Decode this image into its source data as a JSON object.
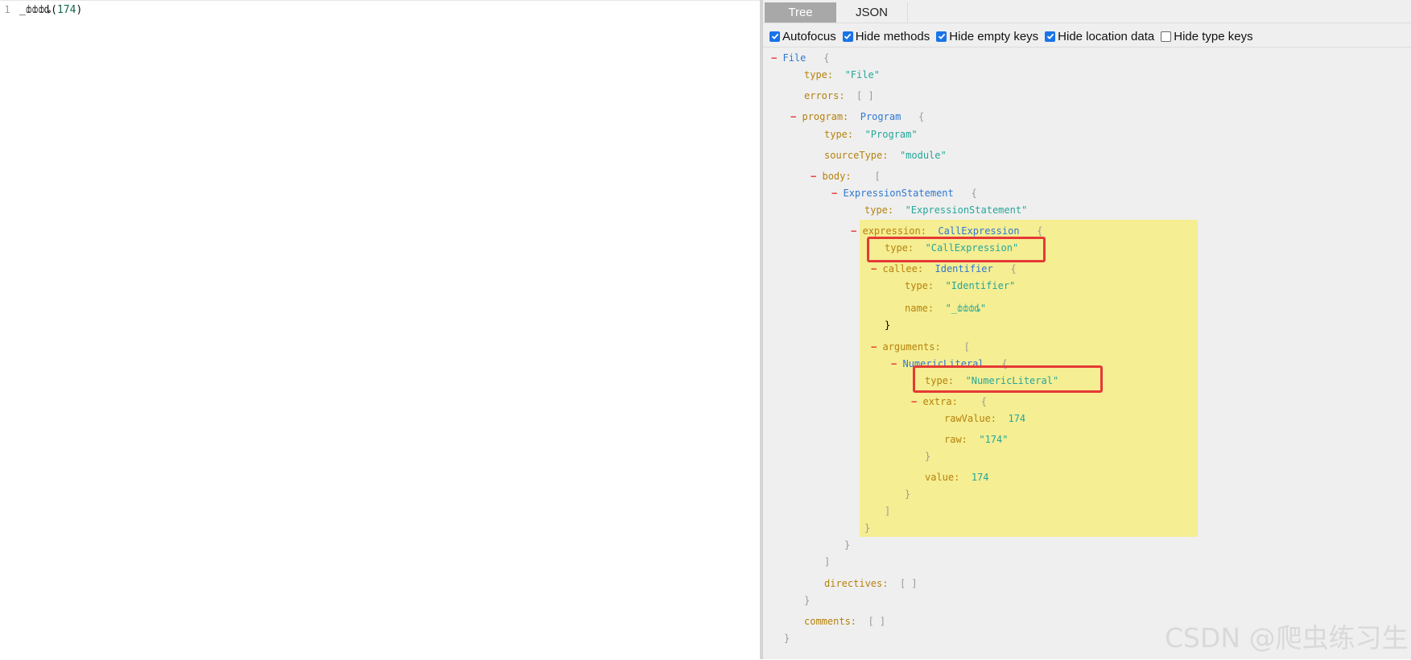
{
  "editor": {
    "line_number": "1",
    "code_ident": "_ȸȸȸȡ",
    "code_open": "(",
    "code_arg": "174",
    "code_close": ")"
  },
  "tabs": [
    "Tree",
    "JSON"
  ],
  "options": [
    {
      "label": "Autofocus",
      "checked": true
    },
    {
      "label": "Hide methods",
      "checked": true
    },
    {
      "label": "Hide empty keys",
      "checked": true
    },
    {
      "label": "Hide location data",
      "checked": true
    },
    {
      "label": "Hide type keys",
      "checked": false
    }
  ],
  "colors": {
    "highlight": "#f5ee92",
    "annotation_box": "#e53935",
    "toggle": "#e53935"
  },
  "tree": {
    "file": {
      "toggle": "−",
      "type_name": "File",
      "brace": "{",
      "type_key": "type:",
      "type_val": "\"File\"",
      "errors_key": "errors:",
      "errors_val": "[ ]",
      "close": "}"
    },
    "program": {
      "toggle": "−",
      "key": "program:",
      "type_name": "Program",
      "brace": "{",
      "type_key": "type:",
      "type_val": "\"Program\"",
      "sourcetype_key": "sourceType:",
      "sourcetype_val": "\"module\"",
      "directives_key": "directives:",
      "directives_val": "[ ]",
      "close": "}"
    },
    "body": {
      "toggle": "−",
      "key": "body:",
      "brace": "[",
      "close": "]"
    },
    "expr_stmt": {
      "toggle": "−",
      "type_name": "ExpressionStatement",
      "brace": "{",
      "type_key": "type:",
      "type_val": "\"ExpressionStatement\"",
      "close": "}"
    },
    "expression": {
      "toggle": "−",
      "key": "expression:",
      "type_name": "CallExpression",
      "brace": "{",
      "type_key": "type:",
      "type_val": "\"CallExpression\"",
      "close": "}"
    },
    "callee": {
      "toggle": "−",
      "key": "callee:",
      "type_name": "Identifier",
      "brace": "{",
      "type_key": "type:",
      "type_val": "\"Identifier\"",
      "name_key": "name:",
      "name_val": "\"_ȸȸȸȡ\"",
      "close": "}"
    },
    "arguments": {
      "toggle": "−",
      "key": "arguments:",
      "brace": "[",
      "close": "]"
    },
    "numeric": {
      "toggle": "−",
      "type_name": "NumericLiteral",
      "brace": "{",
      "type_key": "type:",
      "type_val": "\"NumericLiteral\"",
      "value_key": "value:",
      "value_val": "174",
      "close": "}"
    },
    "extra": {
      "toggle": "−",
      "key": "extra:",
      "brace": "{",
      "rawvalue_key": "rawValue:",
      "rawvalue_val": "174",
      "raw_key": "raw:",
      "raw_val": "\"174\"",
      "close": "}"
    },
    "comments": {
      "key": "comments:",
      "val": "[ ]"
    }
  },
  "watermark": "CSDN @爬虫练习生"
}
